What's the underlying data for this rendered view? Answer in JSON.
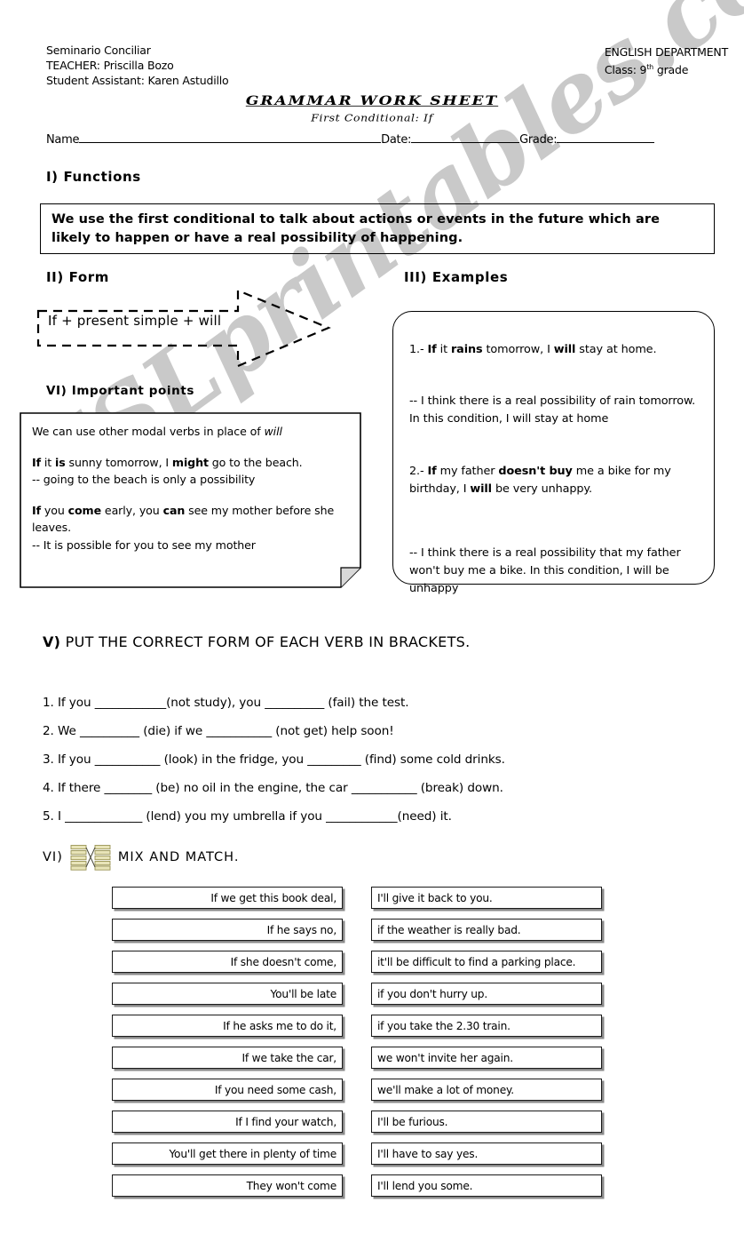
{
  "header": {
    "school": "Seminario Conciliar",
    "teacher": "TEACHER: Priscilla Bozo",
    "assistant": "Student Assistant: Karen Astudillo",
    "department": "ENGLISH DEPARTMENT",
    "class_label": "Class: 9",
    "class_sup": "th",
    "class_suffix": " grade",
    "title": "GRAMMAR WORK SHEET",
    "subtitle": "First Conditional: If",
    "name_label": "Name",
    "date_label": "Date:",
    "grade_label": "Grade:"
  },
  "sections": {
    "functions_heading": "I) Functions",
    "functions_text": "We use the first conditional to talk about actions or events in the future which are likely to happen or have a real possibility of happening.",
    "form_heading": "II) Form",
    "form_formula": "If + present simple + will",
    "examples_heading": "III) Examples",
    "important_heading": "VI) Important points",
    "exercise_heading_num": "V)",
    "exercise_heading_text": " PUT THE CORRECT FORM OF EACH VERB IN BRACKETS.",
    "mixmatch_heading_num": "VI)",
    "mixmatch_heading_text": "MIX AND MATCH."
  },
  "important_points": {
    "intro_a": "We can use other modal verbs in place of ",
    "intro_italic": "will",
    "ex1_bold1": "If",
    "ex1_mid1": " it ",
    "ex1_bold2": "is",
    "ex1_mid2": " sunny tomorrow, I ",
    "ex1_bold3": "might",
    "ex1_end": " go to the beach.",
    "ex1_note": "-- going to the beach is only a possibility",
    "ex2_bold1": "If",
    "ex2_mid1": " you ",
    "ex2_bold2": "come",
    "ex2_mid2": " early, you ",
    "ex2_bold3": "can",
    "ex2_end": " see my mother before she leaves.",
    "ex2_note": "-- It is possible for you to see my mother"
  },
  "examples": {
    "e1_num": "1.- ",
    "e1_bold1": "If",
    "e1_mid1": " it ",
    "e1_bold2": "rains",
    "e1_mid2": " tomorrow, I ",
    "e1_bold3": "will",
    "e1_end": " stay at home.",
    "e1_note": "-- I think there is a real possibility of rain tomorrow. In this condition, I will stay at home",
    "e2_num": "2.- ",
    "e2_bold1": "If",
    "e2_mid1": " my father ",
    "e2_bold2": "doesn't buy",
    "e2_mid2": " me a bike for my birthday, I ",
    "e2_bold3": "will",
    "e2_end": " be very unhappy.",
    "e2_note": "-- I think there is a real possibility that my father won't buy me a bike. In this condition, I will be unhappy"
  },
  "exercise_items": [
    "1. If you ____________(not study), you __________ (fail) the test.",
    "2. We __________ (die) if we ___________ (not get) help soon!",
    "3. If you ___________ (look) in the fridge, you _________ (find) some cold drinks.",
    "4. If there ________ (be) no oil in the engine, the car ___________ (break) down.",
    "5. I _____________ (lend) you my umbrella if you ____________(need) it."
  ],
  "match_left": [
    "If we get this book deal,",
    "If he says no,",
    "If she doesn't come,",
    "You'll be late",
    "If he asks me to do it,",
    "If we take the car,",
    "If you need some cash,",
    "If I find your watch,",
    "You'll get there in plenty of time",
    "They won't come"
  ],
  "match_right": [
    "I'll give it back to you.",
    "if the weather is really bad.",
    "it'll be difficult to find a parking place.",
    "if you don't hurry up.",
    "if you take the 2.30 train.",
    "we won't invite her again.",
    "we'll make a lot of money.",
    "I'll be furious.",
    "I'll have to say yes.",
    "I'll lend you some."
  ],
  "watermark": {
    "text": "ESLprintables.com",
    "color": "#c9c9c9"
  },
  "icons": {
    "match_icon_color": "#d9d49a"
  }
}
